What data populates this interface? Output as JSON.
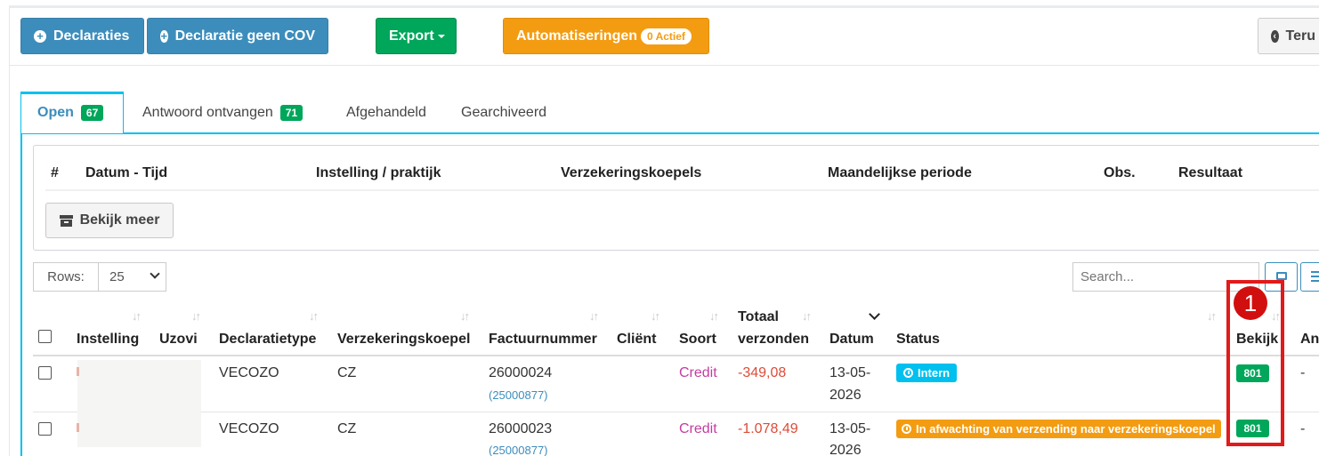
{
  "toolbar": {
    "declaraties": "Declaraties",
    "declaratie_geen_cov": "Declaratie geen COV",
    "export": "Export",
    "automatiseringen": "Automatiseringen",
    "automatiseringen_badge": "0 Actief",
    "terug": "Teru"
  },
  "tabs": [
    {
      "label": "Open",
      "count": "67",
      "active": true
    },
    {
      "label": "Antwoord ontvangen",
      "count": "71"
    },
    {
      "label": "Afgehandeld"
    },
    {
      "label": "Gearchiveerd"
    }
  ],
  "summary_table": {
    "headers": [
      "#",
      "Datum - Tijd",
      "Instelling / praktijk",
      "Verzekeringskoepels",
      "Maandelijkse periode",
      "Obs.",
      "Resultaat"
    ],
    "view_more": "Bekijk meer"
  },
  "controls": {
    "rows_label": "Rows:",
    "rows_value": "25",
    "search_placeholder": "Search..."
  },
  "table": {
    "headers": {
      "instelling": "Instelling",
      "uzovi": "Uzovi",
      "declaratietype": "Declaratietype",
      "verzekeringskoepel": "Verzekeringskoepel",
      "factuurnummer": "Factuurnummer",
      "client": "Cliënt",
      "soort": "Soort",
      "totaal_1": "Totaal",
      "totaal_2": "verzonden",
      "datum": "Datum",
      "status": "Status",
      "bekijk": "Bekijk",
      "annuleer": "Anı"
    },
    "rows": [
      {
        "declaratietype": "VECOZO",
        "verzekeringskoepel": "CZ",
        "factuurnummer": "26000024",
        "factuur_ref": "(25000877)",
        "soort": "Credit",
        "totaal": "-349,08",
        "datum_1": "13-05-",
        "datum_2": "2026",
        "status": "Intern",
        "bekijk": "801",
        "annuleer": "-"
      },
      {
        "declaratietype": "VECOZO",
        "verzekeringskoepel": "CZ",
        "factuurnummer": "26000023",
        "factuur_ref": "(25000877)",
        "soort": "Credit",
        "totaal": "-1.078,49",
        "datum_1": "13-05-",
        "datum_2": "2026",
        "status": "In afwachting van verzending naar verzekeringskoepel",
        "bekijk": "801",
        "annuleer": "-"
      }
    ]
  },
  "annotation": {
    "marker": "1"
  },
  "colors": {
    "primary": "#3c8dbc",
    "success": "#00a65a",
    "warning": "#f39c12",
    "info": "#00c0ef",
    "danger": "#dd4b39",
    "credit": "#c63ca0",
    "highlight": "#e21a1a"
  }
}
